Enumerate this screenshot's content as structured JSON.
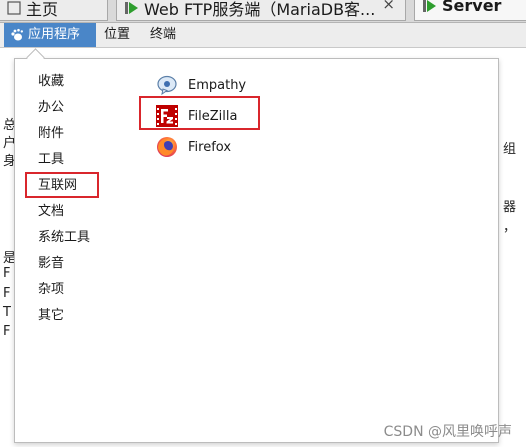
{
  "tabs": [
    {
      "label": "主页",
      "close": ""
    },
    {
      "label": "Web FTP服务端（MariaDB客...",
      "close": "×"
    },
    {
      "label": "Server",
      "close": ""
    }
  ],
  "menubar": {
    "applications": "应用程序",
    "places": "位置",
    "terminal": "终端"
  },
  "background_fragments": {
    "left": [
      "总",
      "户",
      "身",
      "是",
      "F",
      "F",
      "T",
      "F"
    ],
    "right": [
      "组",
      "器",
      "，"
    ]
  },
  "categories": [
    {
      "label": "收藏"
    },
    {
      "label": "办公"
    },
    {
      "label": "附件"
    },
    {
      "label": "工具"
    },
    {
      "label": "互联网",
      "highlighted": true
    },
    {
      "label": "文档"
    },
    {
      "label": "系统工具"
    },
    {
      "label": "影音"
    },
    {
      "label": "杂项"
    },
    {
      "label": "其它"
    }
  ],
  "apps": [
    {
      "label": "Empathy",
      "icon": "empathy-icon"
    },
    {
      "label": "FileZilla",
      "icon": "filezilla-icon",
      "highlighted": true
    },
    {
      "label": "Firefox",
      "icon": "firefox-icon"
    }
  ],
  "watermark": "CSDN @风里唤呼声",
  "colors": {
    "menu_active": "#4a86c8",
    "highlight": "#d9262c",
    "filezilla_red": "#bf0000",
    "firefox_orange": "#ff7139"
  }
}
